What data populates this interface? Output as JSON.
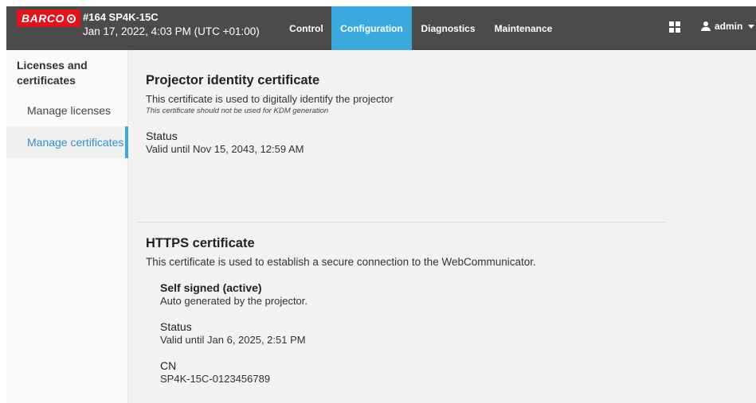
{
  "brand": {
    "logo_text": "BARCO"
  },
  "device": {
    "name": "#164 SP4K-15C",
    "datetime": "Jan 17, 2022, 4:03 PM (UTC +01:00)"
  },
  "nav": {
    "control": "Control",
    "configuration": "Configuration",
    "diagnostics": "Diagnostics",
    "maintenance": "Maintenance"
  },
  "user": {
    "name": "admin"
  },
  "sidebar": {
    "heading": "Licenses and certificates",
    "items": [
      {
        "label": "Manage licenses"
      },
      {
        "label": "Manage certificates"
      }
    ]
  },
  "identity_cert": {
    "title": "Projector identity certificate",
    "description": "This certificate is used to digitally identify the projector",
    "note": "This certificate should not be used for KDM generation",
    "status_label": "Status",
    "status_value": "Valid until Nov 15, 2043, 12:59 AM"
  },
  "https_cert": {
    "title": "HTTPS certificate",
    "description": "This certificate is used to establish a secure connection to the WebCommunicator.",
    "type_label": "Self signed (active)",
    "type_desc": "Auto generated by the projector.",
    "status_label": "Status",
    "status_value": "Valid until Jan 6, 2025, 2:51 PM",
    "cn_label": "CN",
    "cn_value": "SP4K-15C-0123456789"
  },
  "colors": {
    "brand_red": "#e3121b",
    "topbar": "#4b4b4b",
    "accent_blue": "#3aa9e0"
  }
}
